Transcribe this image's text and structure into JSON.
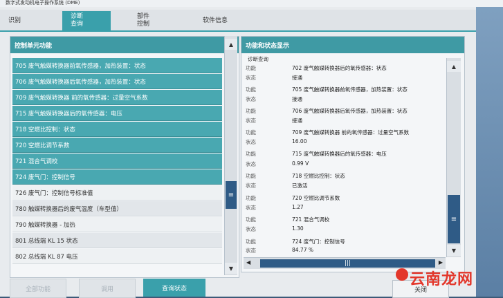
{
  "window": {
    "title": "数字式发动机电子操作系统 (DME)"
  },
  "tabs": [
    {
      "label": "识别"
    },
    {
      "label": "诊断查询"
    },
    {
      "label": "部件控制"
    },
    {
      "label": "软件信息"
    }
  ],
  "left_panel": {
    "header": "控制单元功能",
    "items": [
      "705 废气触媒转换器前氧传感器，加热装置：状态",
      "706 废气触媒转换器后氧传感器，加热装置：状态",
      "709 废气触媒转换器 前的氧传感器：过量空气系数",
      "715 废气触媒转换器后的氧传感器：电压",
      "718 空燃比控制：状态",
      "720 空燃比调节系数",
      "721 混合气调校",
      "724 废气门：控制信号",
      "726 废气门：控制信号标准值",
      "780 触媒转换器后的废气温度（车型值）",
      "790 触媒转换器 - 加热",
      "801 总线端 KL 15 状态",
      "802 总线端 KL 87 电压"
    ]
  },
  "right_panel": {
    "header": "功能和状态显示",
    "section": "诊断查询",
    "label_func": "功能",
    "label_state": "状态",
    "entries": [
      {
        "func": "702 废气触媒转换器后的氧传感器：状态",
        "state": "接通"
      },
      {
        "func": "705 废气触媒转换器前氧传感器，加热装置：状态",
        "state": "接通"
      },
      {
        "func": "706 废气触媒转换器后氧传感器，加热装置：状态",
        "state": "接通"
      },
      {
        "func": "709 废气触媒转换器 前的氧传感器：过量空气系数",
        "state": "16.00"
      },
      {
        "func": "715 废气触媒转换器后的氧传感器：电压",
        "state": "0.99 V"
      },
      {
        "func": "718 空燃比控制：状态",
        "state": "已激活"
      },
      {
        "func": "720 空燃比调节系数",
        "state": "1.27"
      },
      {
        "func": "721 混合气调校",
        "state": "1.30"
      },
      {
        "func": "724 废气门：控制信号",
        "state": "84.77 %"
      }
    ]
  },
  "bottom": {
    "btn1": "全部功能",
    "btn2": "调用",
    "btn3": "查询状态",
    "close": "关闭"
  },
  "watermark": "云南龙网"
}
